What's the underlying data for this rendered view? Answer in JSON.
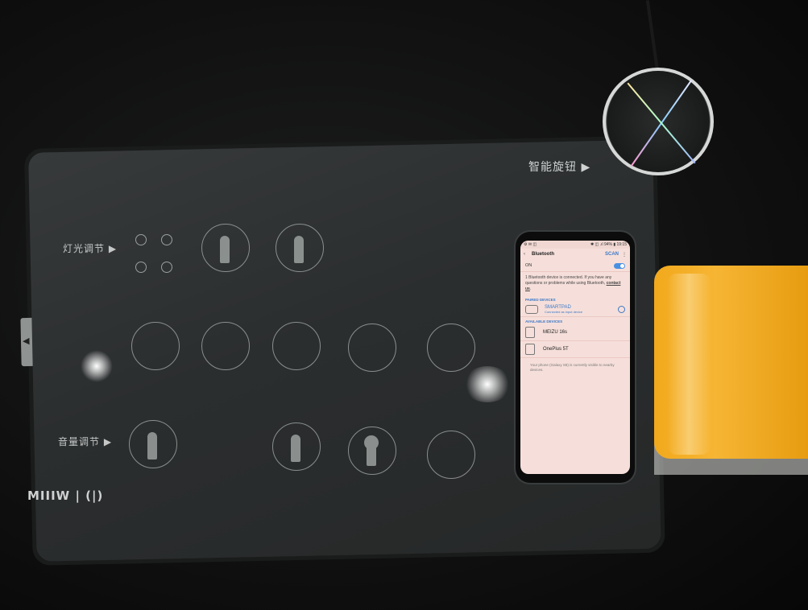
{
  "pad": {
    "knob_label": "智能旋钮 ▶",
    "row_light": "灯光调节 ▶",
    "row_volume": "音量调节 ▶",
    "brand": "MIIIW | (|)"
  },
  "phone": {
    "status_time": "19:15",
    "status_right": "✱ ◫ .ıl 94% ▮ 19:15",
    "title": "Bluetooth",
    "scan": "SCAN",
    "more": "⋮",
    "back": "‹",
    "on_label": "ON",
    "notice_text": "1 Bluetooth device is connected. If you have any questions or problems while using Bluetooth,",
    "notice_link": "contact us",
    "notice_end": ".",
    "paired_header": "PAIRED DEVICES",
    "paired": [
      {
        "name": "SMARTPAD",
        "sub": "Connected as input device"
      }
    ],
    "available_header": "AVAILABLE DEVICES",
    "available": [
      {
        "name": "MEIZU 16s"
      },
      {
        "name": "OnePlus 5T"
      }
    ],
    "footnote": "Your phone (Galaxy S8) is currently visible to nearby devices."
  }
}
